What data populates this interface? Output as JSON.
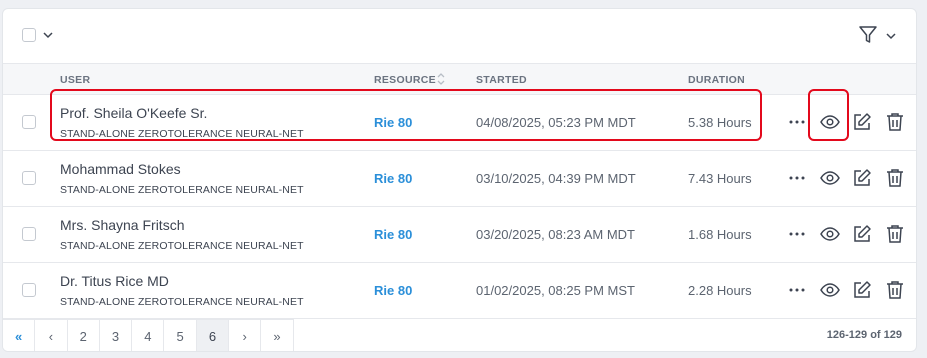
{
  "header": {
    "select_all_checked": false,
    "filter_icon": "filter-icon"
  },
  "columns": {
    "user": "USER",
    "resource": "RESOURCE",
    "started": "STARTED",
    "duration": "DURATION"
  },
  "rows": [
    {
      "name": "Prof. Sheila O'Keefe Sr.",
      "subtitle": "STAND-ALONE ZEROTOLERANCE NEURAL-NET",
      "resource": "Rie 80",
      "started": "04/08/2025, 05:23 PM MDT",
      "duration": "5.38 Hours"
    },
    {
      "name": "Mohammad Stokes",
      "subtitle": "STAND-ALONE ZEROTOLERANCE NEURAL-NET",
      "resource": "Rie 80",
      "started": "03/10/2025, 04:39 PM MDT",
      "duration": "7.43 Hours"
    },
    {
      "name": "Mrs. Shayna Fritsch",
      "subtitle": "STAND-ALONE ZEROTOLERANCE NEURAL-NET",
      "resource": "Rie 80",
      "started": "03/20/2025, 08:23 AM MDT",
      "duration": "1.68 Hours"
    },
    {
      "name": "Dr. Titus Rice MD",
      "subtitle": "STAND-ALONE ZEROTOLERANCE NEURAL-NET",
      "resource": "Rie 80",
      "started": "01/02/2025, 08:25 PM MST",
      "duration": "2.28 Hours"
    }
  ],
  "row_actions": {
    "more": "more-icon",
    "view": "eye-icon",
    "edit": "edit-icon",
    "delete": "trash-icon"
  },
  "pagination": {
    "first": "«",
    "prev": "‹",
    "pages": [
      "2",
      "3",
      "4",
      "5",
      "6"
    ],
    "active_page": "6",
    "next": "›",
    "last": "»",
    "count": "126-129 of 129"
  },
  "colors": {
    "accent": "#2b8fd9",
    "highlight": "#e3091c"
  }
}
